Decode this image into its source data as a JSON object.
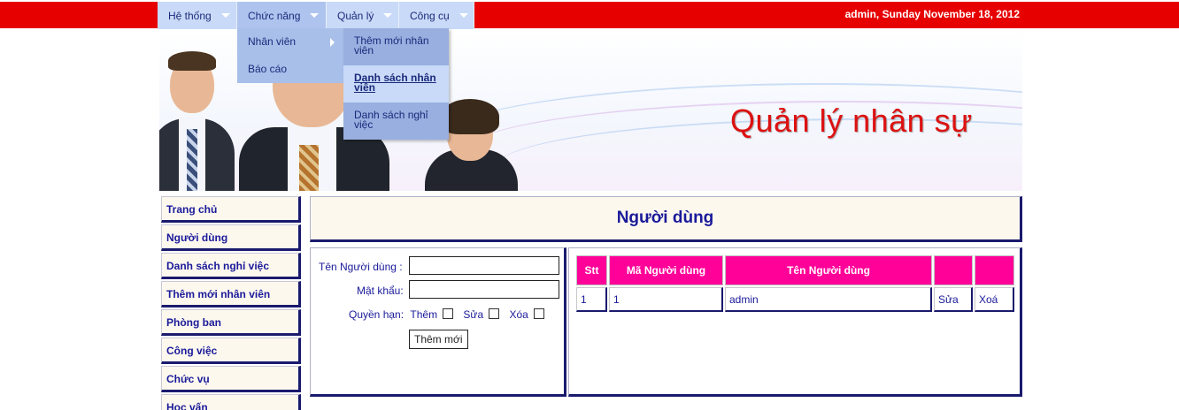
{
  "menubar": {
    "items": [
      {
        "label": "Hệ thống"
      },
      {
        "label": "Chức năng"
      },
      {
        "label": "Quản lý"
      },
      {
        "label": "Công cụ"
      }
    ],
    "user_info": "admin, Sunday November 18, 2012"
  },
  "dropdown_chuc_nang": {
    "items": [
      {
        "label": "Nhân viên"
      },
      {
        "label": "Báo cáo"
      }
    ]
  },
  "dropdown_nhan_vien": {
    "items": [
      {
        "label": "Thêm mới nhân viên"
      },
      {
        "label": "Danh sách nhân viên"
      },
      {
        "label": "Danh sách nghỉ việc"
      }
    ]
  },
  "banner": {
    "title": "Quản lý nhân sự"
  },
  "sidebar": {
    "items": [
      {
        "label": "Trang chủ"
      },
      {
        "label": "Người dùng"
      },
      {
        "label": "Danh sách nghỉ việc"
      },
      {
        "label": "Thêm mới nhân viên"
      },
      {
        "label": "Phòng ban"
      },
      {
        "label": "Công việc"
      },
      {
        "label": "Chức vụ"
      },
      {
        "label": "Học vấn"
      }
    ]
  },
  "main": {
    "title": "Người dùng"
  },
  "form": {
    "username_label": "Tên Người dùng :",
    "username_value": "",
    "password_label": "Mật khẩu:",
    "password_value": "",
    "permissions_label": "Quyền hạn:",
    "perm_add_label": "Thêm",
    "perm_edit_label": "Sửa",
    "perm_delete_label": "Xóa",
    "submit_label": "Thêm mới"
  },
  "table": {
    "headers": [
      "Stt",
      "Mã Người dùng",
      "Tên Người dùng",
      "",
      ""
    ],
    "rows": [
      {
        "stt": "1",
        "ma": "1",
        "ten": "admin",
        "edit": "Sửa",
        "delete": "Xoá"
      }
    ]
  },
  "colors": {
    "topbar": "#e60000",
    "menu": "#c9daf8",
    "table_header": "#ff0099",
    "nav_text": "#1a1a9a"
  }
}
